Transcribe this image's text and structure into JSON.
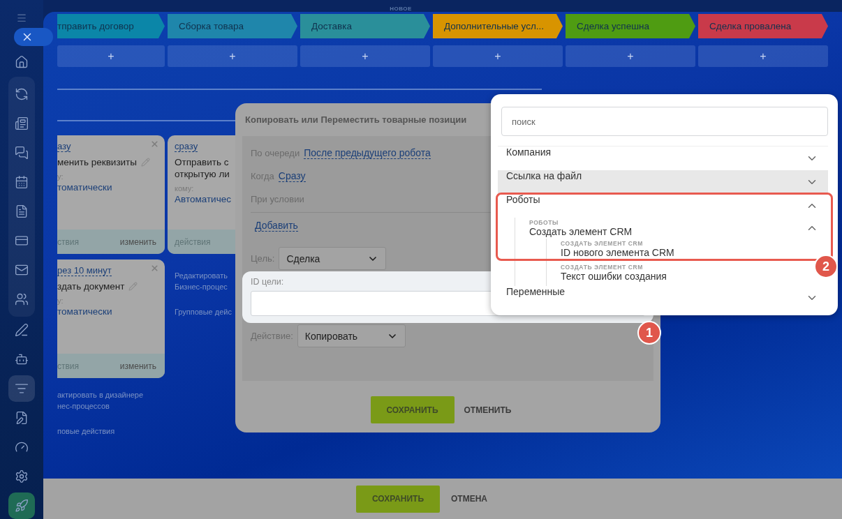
{
  "header": {
    "badge": "НОВОЕ"
  },
  "sidebar": {
    "items": [
      {
        "selected": false
      },
      {
        "selected": false
      },
      {
        "selected": false
      },
      {
        "selected": false
      },
      {
        "selected": false
      },
      {
        "selected": false
      },
      {
        "selected": false
      },
      {
        "selected": false
      },
      {
        "selected": false
      },
      {
        "selected": false
      },
      {
        "selected": false
      },
      {
        "selected": true
      },
      {
        "selected": false
      },
      {
        "selected": false
      },
      {
        "selected": false
      },
      {
        "selected": false
      }
    ]
  },
  "stages": [
    {
      "label": "тправить договор",
      "color": "#0b86a8",
      "add": "+"
    },
    {
      "label": "Сборка товара",
      "color": "#1f86ab",
      "add": "+"
    },
    {
      "label": "Доставка",
      "color": "#2a8f9a",
      "add": "+"
    },
    {
      "label": "Дополнительные усл...",
      "color": "#d89400",
      "add": "+"
    },
    {
      "label": "Сделка успешна",
      "color": "#4f9c12",
      "add": "+"
    },
    {
      "label": "Сделка провалена",
      "color": "#c93a4a",
      "add": "+"
    }
  ],
  "columns": [
    {
      "cards": [
        {
          "when": "азу",
          "title": "менить реквизиты",
          "editable": true,
          "closable": true,
          "to": "у:",
          "who": "томатически",
          "actions": "ствия",
          "edit": "изменить"
        },
        {
          "when": "рез 10 минут",
          "title": "здать документ",
          "editable": true,
          "closable": true,
          "to": "у:",
          "who": "томатически",
          "actions": "ствия",
          "edit": "изменить"
        }
      ],
      "links": [
        {
          "lines": [
            "актировать в дизайнере",
            "нес-процессов"
          ]
        },
        {
          "lines": [
            "повые действия"
          ]
        }
      ]
    },
    {
      "cards": [
        {
          "when": "сразу",
          "title": "Отправить с открытую ли",
          "editable": false,
          "closable": false,
          "to": "кому:",
          "who": "Автоматичес",
          "actions": "действия"
        }
      ],
      "links": [
        {
          "lines": [
            "Редактировать",
            "Бизнес-процес"
          ]
        },
        {
          "lines": [
            "Групповые дейс"
          ]
        }
      ]
    }
  ],
  "modal": {
    "title": "Копировать или Переместить товарные позиции",
    "fields": [
      {
        "kind": "link",
        "label": "По очереди",
        "value": "После предыдущего робота"
      },
      {
        "kind": "link",
        "label": "Когда",
        "value": "Сразу"
      },
      {
        "kind": "condition",
        "label": "При условии",
        "value": "Добавить"
      },
      {
        "kind": "select",
        "label": "Цель:",
        "value": "Сделка"
      },
      {
        "kind": "input",
        "label": "ID цели:",
        "highlighted": true
      },
      {
        "kind": "select",
        "label": "Действие:",
        "value": "Копировать"
      }
    ],
    "buttons": [
      {
        "kind": "primary",
        "label": "СОХРАНИТЬ"
      },
      {
        "kind": "text",
        "label": "ОТМЕНИТЬ"
      }
    ]
  },
  "footer": {
    "buttons": [
      {
        "kind": "primary",
        "label": "СОХРАНИТЬ"
      },
      {
        "kind": "text",
        "label": "ОТМЕНА"
      }
    ]
  },
  "picker": {
    "placeholder": "поиск",
    "categories": [
      {
        "label": "Компания",
        "expanded": false,
        "hovered": false
      },
      {
        "label": "Ссылка на файл",
        "expanded": false,
        "hovered": true
      },
      {
        "label": "Роботы",
        "expanded": true,
        "hovered": false,
        "children": [
          {
            "group": "РОБОТЫ",
            "label": "Создать элемент CRM",
            "expanded": true,
            "children": [
              {
                "group": "СОЗДАТЬ ЭЛЕМЕНТ CRM",
                "label": "ID нового элемента CRM"
              },
              {
                "group": "СОЗДАТЬ ЭЛЕМЕНТ CRM",
                "label": "Текст ошибки создания"
              }
            ]
          }
        ]
      },
      {
        "label": "Переменные",
        "expanded": false,
        "hovered": false
      }
    ]
  },
  "annotations": [
    {
      "label": "1"
    },
    {
      "label": "2"
    }
  ]
}
